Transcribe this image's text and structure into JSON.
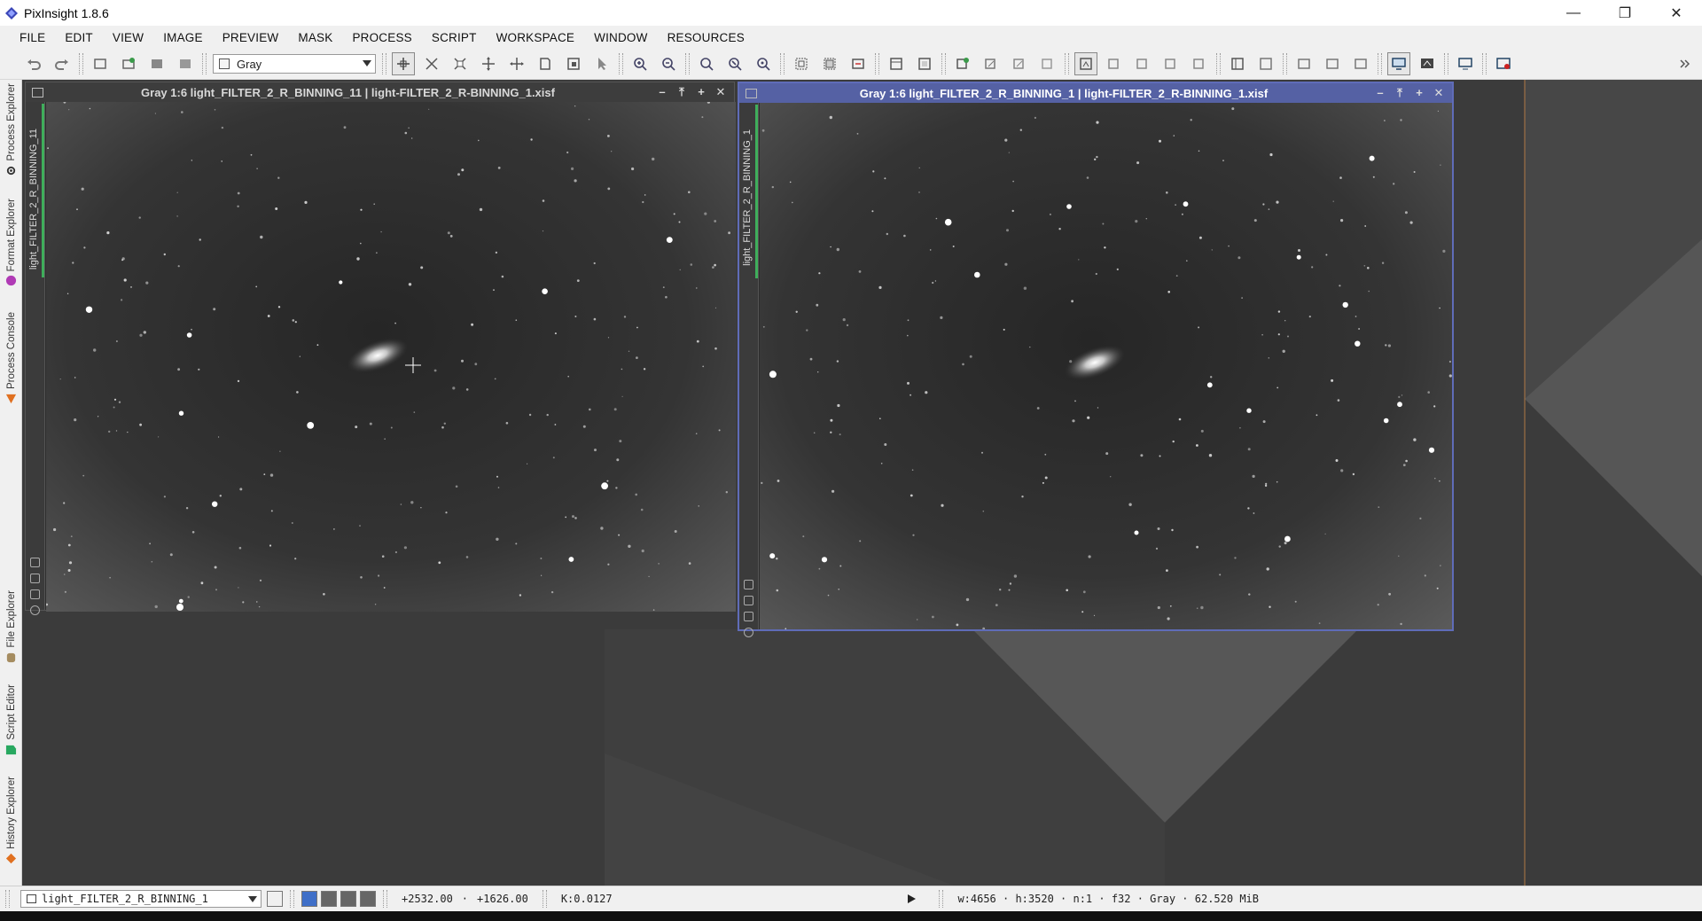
{
  "app": {
    "title": "PixInsight 1.8.6",
    "window_controls": [
      "—",
      "❐",
      "✕"
    ]
  },
  "menu": [
    "FILE",
    "EDIT",
    "VIEW",
    "IMAGE",
    "PREVIEW",
    "MASK",
    "PROCESS",
    "SCRIPT",
    "WORKSPACE",
    "WINDOW",
    "RESOURCES"
  ],
  "toolbar": {
    "channel_select": "Gray"
  },
  "sidebar": {
    "tabs": [
      "Process Explorer",
      "Format Explorer",
      "Process Console",
      "File Explorer",
      "Script Editor",
      "History Explorer"
    ]
  },
  "windows": [
    {
      "title": "Gray 1:6 light_FILTER_2_R_BINNING_11 | light-FILTER_2_R-BINNING_1.xisf",
      "view_id": "light_FILTER_2_R_BINNING_11",
      "active": false
    },
    {
      "title": "Gray 1:6 light_FILTER_2_R_BINNING_1 | light-FILTER_2_R-BINNING_1.xisf",
      "view_id": "light_FILTER_2_R_BINNING_1",
      "active": true
    }
  ],
  "window_controls": [
    "–",
    "⤒",
    "+",
    "✕"
  ],
  "statusbar": {
    "view_select": "light_FILTER_2_R_BINNING_1",
    "coords_x": "+2532.00",
    "coords_y": "+1626.00",
    "value": "K:0.0127",
    "image_info": "w:4656 · h:3520 · n:1 · f32 · Gray · 62.520 MiB"
  },
  "colors": {
    "active_title": "#5561a4",
    "workspace": "#3b3b3b",
    "accent_green": "#3fae5b"
  }
}
